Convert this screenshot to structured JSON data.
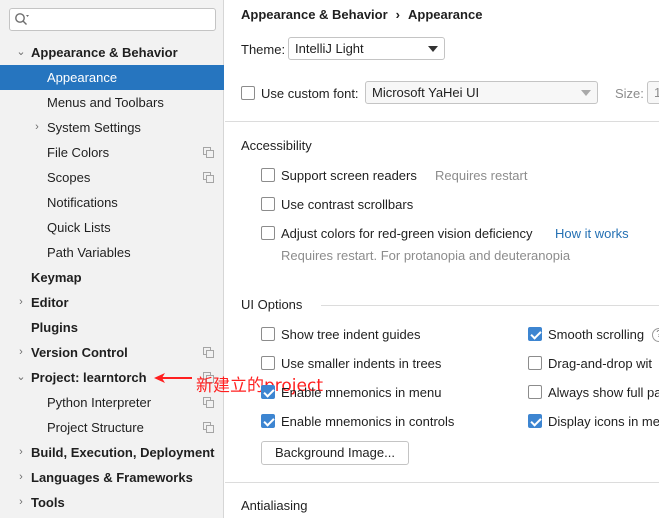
{
  "sidebar": {
    "search": {
      "value": "",
      "icon": "search-icon"
    },
    "items": [
      {
        "label": "Appearance & Behavior",
        "arrow": "⌄",
        "level": 0,
        "bold": true
      },
      {
        "label": "Appearance",
        "arrow": "",
        "level": 1,
        "bold": false,
        "selected": true
      },
      {
        "label": "Menus and Toolbars",
        "arrow": "",
        "level": 1,
        "bold": false
      },
      {
        "label": "System Settings",
        "arrow": "›",
        "level": 1,
        "bold": false
      },
      {
        "label": "File Colors",
        "arrow": "",
        "level": 1,
        "bold": false,
        "copy": true
      },
      {
        "label": "Scopes",
        "arrow": "",
        "level": 1,
        "bold": false,
        "copy": true
      },
      {
        "label": "Notifications",
        "arrow": "",
        "level": 1,
        "bold": false
      },
      {
        "label": "Quick Lists",
        "arrow": "",
        "level": 1,
        "bold": false
      },
      {
        "label": "Path Variables",
        "arrow": "",
        "level": 1,
        "bold": false
      },
      {
        "label": "Keymap",
        "arrow": "",
        "level": 0,
        "bold": true
      },
      {
        "label": "Editor",
        "arrow": "›",
        "level": 0,
        "bold": true
      },
      {
        "label": "Plugins",
        "arrow": "",
        "level": 0,
        "bold": true
      },
      {
        "label": "Version Control",
        "arrow": "›",
        "level": 0,
        "bold": true,
        "copy": true
      },
      {
        "label": "Project: learntorch",
        "arrow": "⌄",
        "level": 0,
        "bold": true,
        "copy": true
      },
      {
        "label": "Python Interpreter",
        "arrow": "",
        "level": 1,
        "bold": false,
        "copy": true
      },
      {
        "label": "Project Structure",
        "arrow": "",
        "level": 1,
        "bold": false,
        "copy": true
      },
      {
        "label": "Build, Execution, Deployment",
        "arrow": "›",
        "level": 0,
        "bold": true
      },
      {
        "label": "Languages & Frameworks",
        "arrow": "›",
        "level": 0,
        "bold": true
      },
      {
        "label": "Tools",
        "arrow": "›",
        "level": 0,
        "bold": true
      }
    ]
  },
  "annotation": {
    "text": "新建立的project",
    "color": "#ff1f1f"
  },
  "breadcrumb": {
    "parent": "Appearance & Behavior",
    "sep": "›",
    "current": "Appearance"
  },
  "theme": {
    "label": "Theme:",
    "value": "IntelliJ Light"
  },
  "font": {
    "checkbox_label": "Use custom font:",
    "value": "Microsoft YaHei UI",
    "size_label": "Size:",
    "size_value": "1"
  },
  "accessibility": {
    "title": "Accessibility",
    "screen_readers": "Support screen readers",
    "requires_restart": "Requires restart",
    "contrast_scrollbars": "Use contrast scrollbars",
    "adjust_colors": "Adjust colors for red-green vision deficiency",
    "how_it_works": "How it works",
    "adjust_hint": "Requires restart. For protanopia and deuteranopia"
  },
  "ui_options": {
    "title": "UI Options",
    "tree_indent": "Show tree indent guides",
    "smaller_indents": "Use smaller indents in trees",
    "mnemonics_menu": "Enable mnemonics in menu",
    "mnemonics_controls": "Enable mnemonics in controls",
    "smooth_scrolling": "Smooth scrolling",
    "drag_drop": "Drag-and-drop wit",
    "always_show": "Always show full pa",
    "display_icons": "Display icons in me",
    "background_button": "Background Image..."
  },
  "antialiasing": {
    "title": "Antialiasing"
  },
  "colors": {
    "selection": "#2675bf",
    "accent": "#3d85d1",
    "link": "#2470b3"
  }
}
